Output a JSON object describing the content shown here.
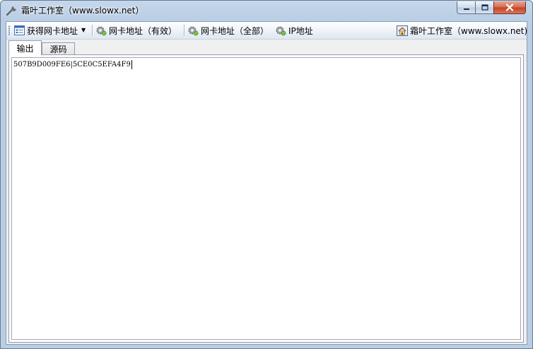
{
  "window": {
    "title": "霜叶工作室（www.slowx.net）",
    "icons": {
      "app": "wrench-icon",
      "minimize": "minimize-icon",
      "maximize": "maximize-icon",
      "close": "close-icon"
    }
  },
  "toolbar": {
    "get_mac_label": "获得网卡地址",
    "get_mac_icon": "window-list-icon",
    "mac_valid_label": "网卡地址（有效）",
    "mac_all_label": "网卡地址（全部）",
    "ip_label": "IP地址",
    "gear_icon": "gear-icon",
    "home_label": "霜叶工作室（www.slowx.net)",
    "home_icon": "home-icon"
  },
  "tabs": [
    {
      "label": "输出",
      "active": true
    },
    {
      "label": "源码",
      "active": false
    }
  ],
  "output": {
    "text": "507B9D009FE6|5CE0C5EFA4F9"
  },
  "colors": {
    "frame": "#b9cde4",
    "close_button": "#c2421f",
    "toolbar_top": "#fdfeff",
    "toolbar_bottom": "#dfe6f0"
  }
}
